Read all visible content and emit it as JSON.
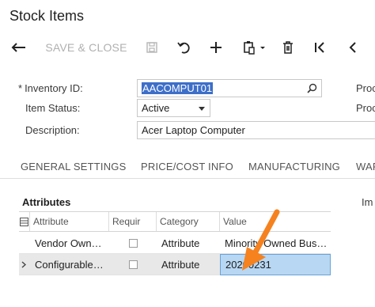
{
  "page": {
    "title": "Stock Items"
  },
  "toolbar": {
    "back_icon": "arrow-left-icon",
    "save_close_label": "SAVE & CLOSE",
    "save_icon": "floppy-disk-icon",
    "undo_icon": "undo-icon",
    "add_icon": "plus-icon",
    "clipboard_icon": "clipboard-dropdown-icon",
    "delete_icon": "trash-icon",
    "first_icon": "first-record-icon",
    "prev_icon": "previous-record-icon"
  },
  "form": {
    "inventory_id_label": "Inventory ID:",
    "inventory_id_required": "*",
    "inventory_id_value": "AACOMPUT01",
    "item_status_label": "Item Status:",
    "item_status_value": "Active",
    "description_label": "Description:",
    "description_value": "Acer Laptop Computer",
    "right_label_1": "Proc",
    "right_label_2": "Proc"
  },
  "tabs": [
    "GENERAL SETTINGS",
    "PRICE/COST INFO",
    "MANUFACTURING",
    "WAR"
  ],
  "attributes": {
    "title": "Attributes",
    "right_label": "Im",
    "columns": [
      "Attribute",
      "Requir",
      "Category",
      "Value"
    ],
    "rows": [
      {
        "attribute": "Vendor Own…",
        "required": false,
        "category": "Attribute",
        "value": "Minority Owned Bus…"
      },
      {
        "attribute": "Configurable…",
        "required": false,
        "category": "Attribute",
        "value": "20200231"
      }
    ]
  },
  "colors": {
    "accent": "#3d6fc9",
    "arrow": "#f5821f",
    "selected_cell": "#b8d7f3"
  }
}
